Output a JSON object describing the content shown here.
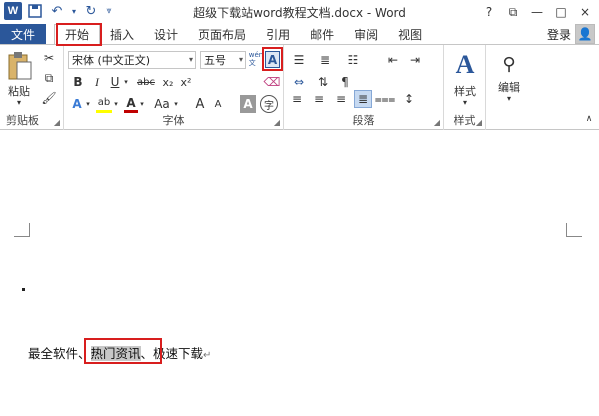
{
  "window": {
    "title": "超级下载站word教程文档.docx - Word",
    "help": "?",
    "restore": "⧉",
    "minimize": "—",
    "maximize": "□",
    "close": "×"
  },
  "tabs": {
    "file": "文件",
    "items": [
      "开始",
      "插入",
      "设计",
      "页面布局",
      "引用",
      "邮件",
      "审阅",
      "视图"
    ],
    "login": "登录"
  },
  "ribbon": {
    "clipboard": {
      "label": "剪贴板",
      "paste": "粘贴"
    },
    "font": {
      "label": "字体",
      "font_name": "宋体 (中文正文)",
      "font_size": "五号",
      "char_border_glyph": "A",
      "wen_glyph": "wén\n文",
      "bold": "B",
      "italic": "I",
      "underline": "U",
      "strike": "abc",
      "sub": "x₂",
      "sup": "x²",
      "text_effect": "A",
      "highlight": "ab",
      "font_color": "A",
      "change_case": "Aa",
      "grow": "A",
      "shrink": "A",
      "char_shading": "A",
      "enclose": "字"
    },
    "paragraph": {
      "label": "段落"
    },
    "styles": {
      "label": "样式",
      "button": "样式"
    },
    "editing": {
      "button": "编辑"
    }
  },
  "document": {
    "line_before": "最全软件、",
    "selected": "热门资讯",
    "line_after": "、极速下载",
    "paragraph_mark": "↵"
  },
  "colors": {
    "word_blue": "#2b579a",
    "highlight_red": "#d81e1e",
    "selection_gray": "#c8c8c8"
  }
}
